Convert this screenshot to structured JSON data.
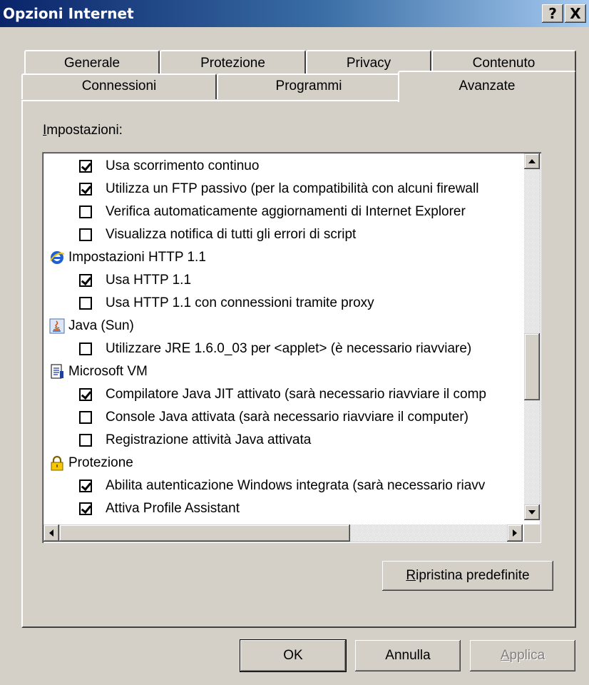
{
  "window": {
    "title": "Opzioni Internet",
    "help_btn": "?",
    "close_btn": "X"
  },
  "tabs_row1": [
    "Generale",
    "Protezione",
    "Privacy",
    "Contenuto"
  ],
  "tabs_row2": [
    "Connessioni",
    "Programmi",
    "Avanzate"
  ],
  "active_tab": "Avanzate",
  "settings_label": {
    "accel": "I",
    "rest": "mpostazioni:"
  },
  "settings_list": [
    {
      "kind": "checkbox",
      "checked": true,
      "label": "Usa scorrimento continuo"
    },
    {
      "kind": "checkbox",
      "checked": true,
      "label": "Utilizza un FTP passivo (per la compatibilità con alcuni firewall"
    },
    {
      "kind": "checkbox",
      "checked": false,
      "label": "Verifica automaticamente aggiornamenti di Internet Explorer"
    },
    {
      "kind": "checkbox",
      "checked": false,
      "label": "Visualizza notifica di tutti gli errori di script"
    },
    {
      "kind": "group",
      "icon": "internet-explorer-icon",
      "label": "Impostazioni HTTP 1.1"
    },
    {
      "kind": "checkbox",
      "checked": true,
      "label": "Usa HTTP 1.1"
    },
    {
      "kind": "checkbox",
      "checked": false,
      "label": "Usa HTTP 1.1 con connessioni tramite proxy"
    },
    {
      "kind": "group",
      "icon": "java-icon",
      "label": "Java (Sun)"
    },
    {
      "kind": "checkbox",
      "checked": false,
      "label": "Utilizzare JRE 1.6.0_03 per <applet> (è necessario riavviare)"
    },
    {
      "kind": "group",
      "icon": "document-icon",
      "label": "Microsoft VM"
    },
    {
      "kind": "checkbox",
      "checked": true,
      "label": "Compilatore Java JIT attivato (sarà necessario riavviare il comp"
    },
    {
      "kind": "checkbox",
      "checked": false,
      "label": "Console Java attivata (sarà necessario riavviare il computer)"
    },
    {
      "kind": "checkbox",
      "checked": false,
      "label": "Registrazione attività Java attivata"
    },
    {
      "kind": "group",
      "icon": "lock-icon",
      "label": "Protezione"
    },
    {
      "kind": "checkbox",
      "checked": true,
      "label": "Abilita autenticazione Windows integrata (sarà necessario riavv"
    },
    {
      "kind": "checkbox",
      "checked": true,
      "label": "Attiva Profile Assistant"
    }
  ],
  "restore_button": {
    "accel": "R",
    "rest": "ipristina predefinite"
  },
  "ok_button": "OK",
  "cancel_button": "Annulla",
  "apply_button": {
    "accel": "A",
    "rest": "pplica"
  }
}
